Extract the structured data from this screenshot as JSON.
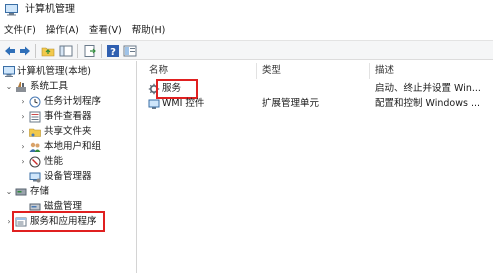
{
  "window": {
    "title": "计算机管理"
  },
  "menu": [
    "文件(F)",
    "操作(A)",
    "查看(V)",
    "帮助(H)"
  ],
  "tree": {
    "root": "计算机管理(本地)",
    "system_tools": "系统工具",
    "task_scheduler": "任务计划程序",
    "event_viewer": "事件查看器",
    "shared_folders": "共享文件夹",
    "local_users": "本地用户和组",
    "performance": "性能",
    "device_manager": "设备管理器",
    "storage": "存储",
    "disk_management": "磁盘管理",
    "services_apps": "服务和应用程序"
  },
  "table": {
    "headers": {
      "name": "名称",
      "type": "类型",
      "description": "描述"
    },
    "rows": [
      {
        "name": "服务",
        "type": "",
        "description": "启动、终止并设置 Win..."
      },
      {
        "name": "WMI 控件",
        "type": "扩展管理单元",
        "description": "配置和控制 Windows ..."
      }
    ]
  },
  "colors": {
    "highlight": "#e02020",
    "toolbar_bg": "#f5f6f7"
  }
}
